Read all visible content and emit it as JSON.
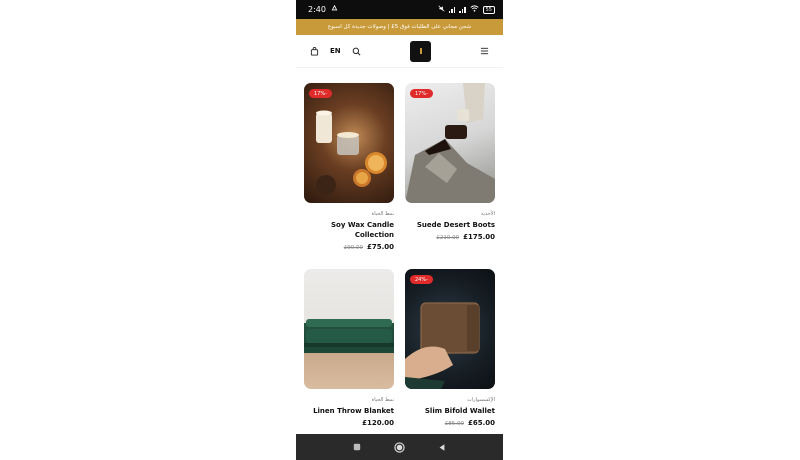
{
  "status_bar": {
    "time": "2:40",
    "battery": "55"
  },
  "promo": {
    "text": "شحن مجاني على الطلبات فوق 5£ | وصولات جديدة كل اسبوع"
  },
  "header": {
    "lang": "EN",
    "icons": [
      "cart-icon",
      "search-icon",
      "menu-icon"
    ]
  },
  "products": [
    {
      "badge": "17%-",
      "category": "نمط الحياة",
      "name": "Soy Wax Candle Collection",
      "old_price": "£90.00",
      "price": "£75.00"
    },
    {
      "badge": "17%-",
      "category": "الأحذية",
      "name": "Suede Desert Boots",
      "old_price": "£210.00",
      "price": "£175.00"
    },
    {
      "badge": "",
      "category": "نمط الحياة",
      "name": "Linen Throw Blanket",
      "old_price": "",
      "price": "£120.00"
    },
    {
      "badge": "24%-",
      "category": "الإكسسوارات",
      "name": "Slim Bifold Wallet",
      "old_price": "£85.00",
      "price": "£65.00"
    }
  ],
  "colors": {
    "banner": "#c99a3a",
    "badge": "#e02b2b",
    "status_bar": "#0d0d0d"
  }
}
